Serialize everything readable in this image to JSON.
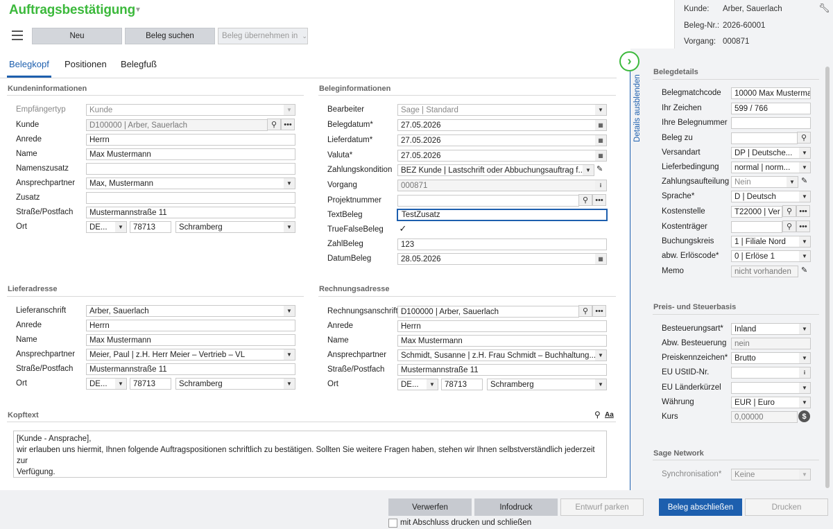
{
  "app": {
    "title": "Auftragsbestätigung"
  },
  "toolbar": {
    "neu": "Neu",
    "beleg_suchen": "Beleg suchen",
    "beleg_uebernehmen": "Beleg übernehmen in"
  },
  "header_info": {
    "kunde_label": "Kunde:",
    "kunde_value": "Arber, Sauerlach",
    "belegnr_label": "Beleg-Nr.:",
    "belegnr_value": "2026-60001",
    "vorgang_label": "Vorgang:",
    "vorgang_value": "000871"
  },
  "tabs": [
    "Belegkopf",
    "Positionen",
    "Belegfuß"
  ],
  "kunde_section": {
    "title": "Kundeninformationen",
    "empfaengertyp_label": "Empfängertyp",
    "empfaengertyp": "Kunde",
    "kunde_label": "Kunde",
    "kunde": "D100000  |  Arber, Sauerlach",
    "anrede_label": "Anrede",
    "anrede": "Herrn",
    "name_label": "Name",
    "name": "Max Mustermann",
    "namenszusatz_label": "Namenszusatz",
    "namenszusatz": "",
    "ansprechpartner_label": "Ansprechpartner",
    "ansprechpartner": "Max, Mustermann",
    "zusatz_label": "Zusatz",
    "zusatz": "",
    "strasse_label": "Straße/Postfach",
    "strasse": "Mustermannstraße 11",
    "ort_label": "Ort",
    "land": "DE...",
    "plz": "78713",
    "ort": "Schramberg"
  },
  "beleg_section": {
    "title": "Beleginformationen",
    "bearbeiter_label": "Bearbeiter",
    "bearbeiter": "Sage  |  Standard",
    "belegdatum_label": "Belegdatum*",
    "belegdatum": "27.05.2026",
    "lieferdatum_label": "Lieferdatum*",
    "lieferdatum": "27.05.2026",
    "valuta_label": "Valuta*",
    "valuta": "27.05.2026",
    "zahlungskondition_label": "Zahlungskondition",
    "zahlungskondition": "BEZ Kunde  |  Lastschrift oder Abbuchungsauftrag f...",
    "vorgang_label": "Vorgang",
    "vorgang": "000871",
    "projektnummer_label": "Projektnummer",
    "projektnummer": "",
    "textbeleg_label": "TextBeleg",
    "textbeleg": "TestZusatz",
    "truefalse_label": "TrueFalseBeleg",
    "zahlbeleg_label": "ZahlBeleg",
    "zahlbeleg": "123",
    "datumbeleg_label": "DatumBeleg",
    "datumbeleg": "28.05.2026"
  },
  "liefer_section": {
    "title": "Lieferadresse",
    "anschrift_label": "Lieferanschrift",
    "anschrift": "Arber, Sauerlach",
    "anrede_label": "Anrede",
    "anrede": "Herrn",
    "name_label": "Name",
    "name": "Max Mustermann",
    "ansprechpartner_label": "Ansprechpartner",
    "ansprechpartner": "Meier, Paul  |  z.H. Herr Meier  –  Vertrieb  –  VL",
    "strasse_label": "Straße/Postfach",
    "strasse": "Mustermannstraße 11",
    "ort_label": "Ort",
    "land": "DE...",
    "plz": "78713",
    "ort": "Schramberg"
  },
  "rechnung_section": {
    "title": "Rechnungsadresse",
    "anschrift_label": "Rechnungsanschrift",
    "anschrift": "D100000  |  Arber, Sauerlach",
    "anrede_label": "Anrede",
    "anrede": "Herrn",
    "name_label": "Name",
    "name": "Max Mustermann",
    "ansprechpartner_label": "Ansprechpartner",
    "ansprechpartner": "Schmidt, Susanne  |  z.H. Frau Schmidt  –  Buchhaltung...",
    "strasse_label": "Straße/Postfach",
    "strasse": "Mustermannstraße 11",
    "ort_label": "Ort",
    "land": "DE...",
    "plz": "78713",
    "ort": "Schramberg"
  },
  "kopftext": {
    "title": "Kopftext",
    "format_label": "Aa",
    "line1": "[Kunde - Ansprache],",
    "line2": "wir erlauben uns hiermit, Ihnen folgende Auftragspositionen schriftlich zu bestätigen. Sollten Sie weitere Fragen haben, stehen wir Ihnen selbstverständlich jederzeit zur",
    "line3": "Verfügung."
  },
  "sidebar": {
    "toggle_label": "Details ausblenden",
    "belegdetails_title": "Belegdetails",
    "belegmatchcode_label": "Belegmatchcode",
    "belegmatchcode": "10000 Max Mustermai",
    "ihr_zeichen_label": "Ihr Zeichen",
    "ihr_zeichen": "599 / 766",
    "ihre_belegnummer_label": "Ihre Belegnummer",
    "ihre_belegnummer": "",
    "beleg_zu_label": "Beleg zu",
    "beleg_zu": "",
    "versandart_label": "Versandart",
    "versandart": "DP  |  Deutsche...",
    "lieferbedingung_label": "Lieferbedingung",
    "lieferbedingung": "normal  |  norm...",
    "zahlungsaufteilung_label": "Zahlungsaufteilung",
    "zahlungsaufteilung": "Nein",
    "sprache_label": "Sprache*",
    "sprache": "D  |  Deutsch",
    "kostenstelle_label": "Kostenstelle",
    "kostenstelle": "T22000  |  Ver",
    "kostentraeger_label": "Kostenträger",
    "kostentraeger": "",
    "buchungskreis_label": "Buchungskreis",
    "buchungskreis": "1  |  Filiale Nord",
    "erloescode_label": "abw. Erlöscode*",
    "erloescode": "0  |  Erlöse 1",
    "memo_label": "Memo",
    "memo": "nicht vorhanden",
    "preis_title": "Preis- und Steuerbasis",
    "besteuerungsart_label": "Besteuerungsart*",
    "besteuerungsart": "Inland",
    "abw_besteuerung_label": "Abw. Besteuerung",
    "abw_besteuerung": "nein",
    "preiskennzeichen_label": "Preiskennzeichen*",
    "preiskennzeichen": "Brutto",
    "ustid_label": "EU UStID-Nr.",
    "ustid": "",
    "laenderkuerzel_label": "EU Länderkürzel",
    "laenderkuerzel": "",
    "waehrung_label": "Währung",
    "waehrung": "EUR  |  Euro",
    "kurs_label": "Kurs",
    "kurs": "0,00000",
    "network_title": "Sage Network",
    "sync_label": "Synchronisation*",
    "sync": "Keine"
  },
  "footer": {
    "verwerfen": "Verwerfen",
    "infodruck": "Infodruck",
    "entwurf": "Entwurf parken",
    "abschliessen": "Beleg abschließen",
    "drucken": "Drucken",
    "checkbox_label": "mit Abschluss drucken und schließen"
  },
  "colors": {
    "accent_green": "#3cb93c",
    "accent_blue": "#1d5fae"
  }
}
